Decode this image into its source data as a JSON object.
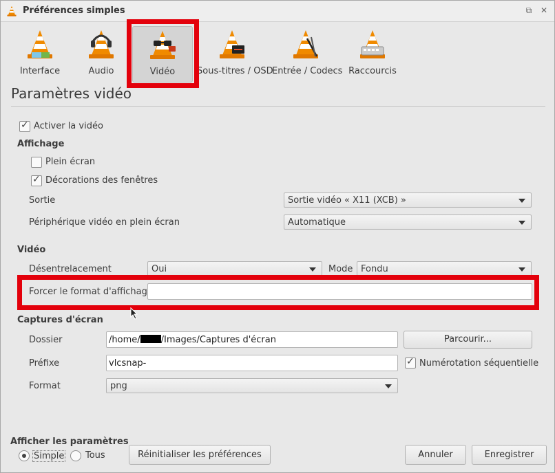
{
  "window": {
    "title": "Préférences simples"
  },
  "categories": [
    {
      "label": "Interface",
      "icon": "vlc-cone-icon"
    },
    {
      "label": "Audio",
      "icon": "headphones-cone-icon"
    },
    {
      "label": "Vidéo",
      "icon": "glasses-cone-icon",
      "selected": true
    },
    {
      "label": "Sous-titres / OSD",
      "icon": "subtitles-cone-icon"
    },
    {
      "label": "Entrée / Codecs",
      "icon": "cables-cone-icon"
    },
    {
      "label": "Raccourcis",
      "icon": "keyboard-cone-icon"
    }
  ],
  "heading": "Paramètres vidéo",
  "enable_video": {
    "label": "Activer la vidéo",
    "checked": true
  },
  "display": {
    "title": "Affichage",
    "fullscreen": {
      "label": "Plein écran",
      "checked": false
    },
    "decorations": {
      "label": "Décorations des fenêtres",
      "checked": true
    },
    "output": {
      "label": "Sortie",
      "value": "Sortie vidéo « X11 (XCB) »"
    },
    "fs_device": {
      "label": "Périphérique vidéo en plein écran",
      "value": "Automatique"
    }
  },
  "video": {
    "title": "Vidéo",
    "deinterlace": {
      "label": "Désentrelacement",
      "value": "Oui"
    },
    "mode": {
      "label": "Mode",
      "value": "Fondu"
    },
    "aspect": {
      "label": "Forcer le format d'affichage",
      "value": ""
    }
  },
  "snapshots": {
    "title": "Captures d'écran",
    "folder": {
      "label": "Dossier",
      "value_start": "/home/",
      "value_end": "/Images/Captures d'écran",
      "browse": "Parcourir..."
    },
    "prefix": {
      "label": "Préfixe",
      "value": "vlcsnap-"
    },
    "sequential": {
      "label": "Numérotation séquentielle",
      "checked": true
    },
    "format": {
      "label": "Format",
      "value": "png"
    }
  },
  "footer": {
    "show_label": "Afficher les paramètres",
    "simple": "Simple",
    "all": "Tous",
    "reset": "Réinitialiser les préférences",
    "cancel": "Annuler",
    "save": "Enregistrer"
  },
  "colors": {
    "highlight": "#e3000b",
    "cone_orange": "#f08a00"
  }
}
